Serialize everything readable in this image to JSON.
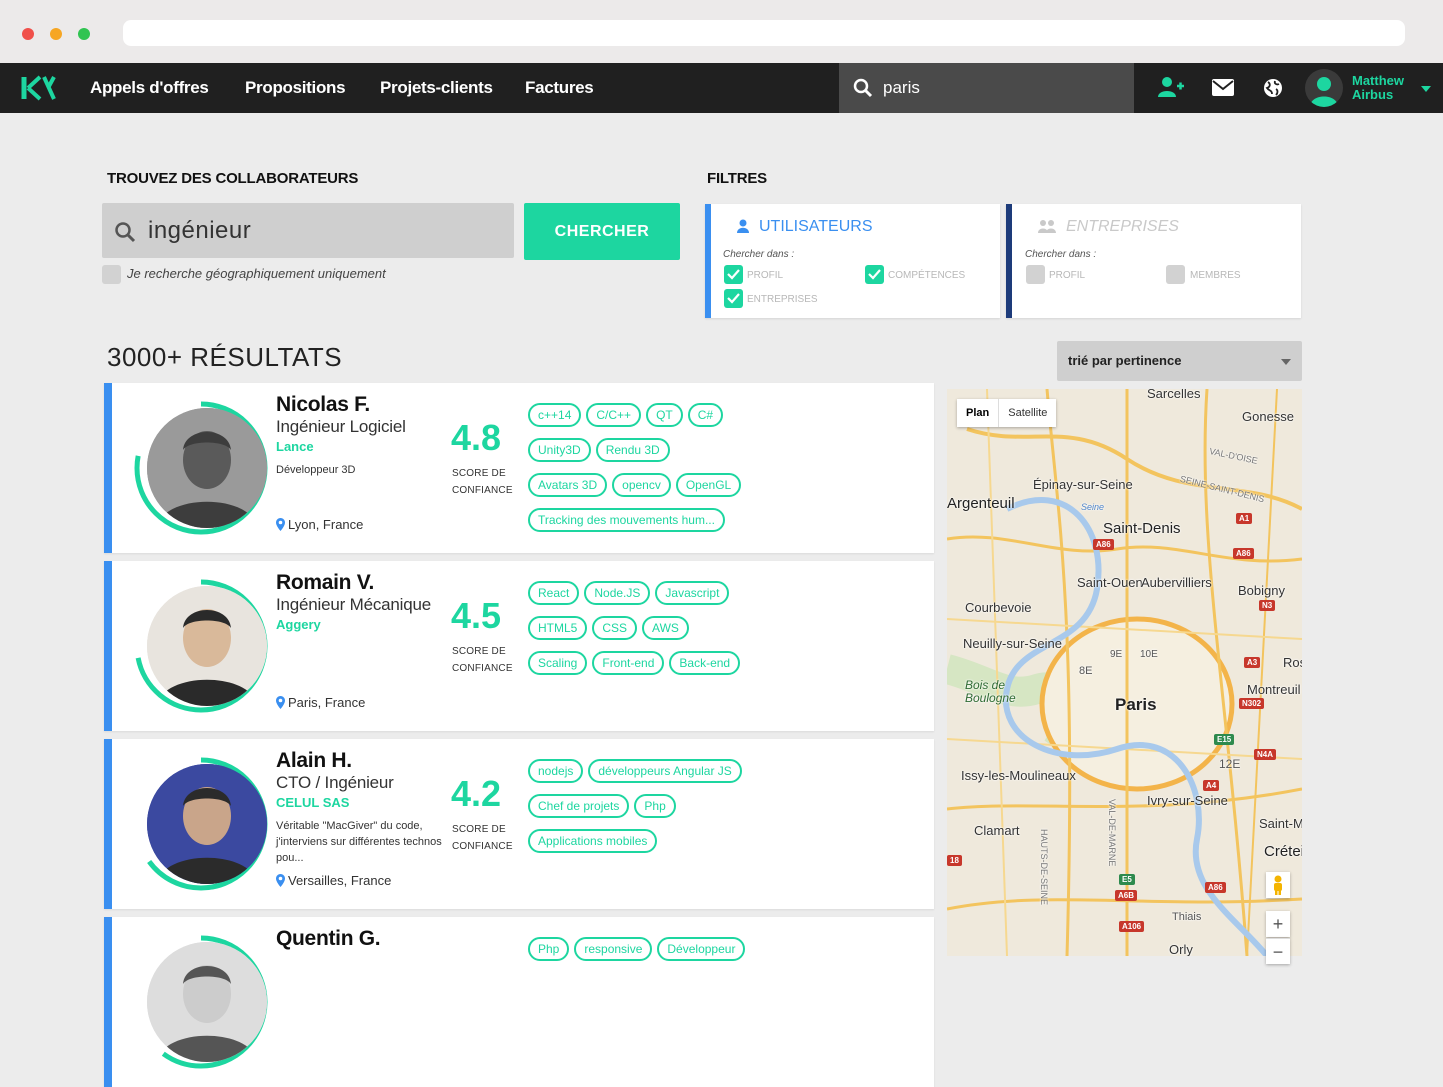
{
  "nav": {
    "links": [
      "Appels d'offres",
      "Propositions",
      "Projets-clients",
      "Factures"
    ],
    "search_value": "paris",
    "user_name_line1": "Matthew",
    "user_name_line2": "Airbus"
  },
  "search": {
    "heading": "TROUVEZ DES COLLABORATEURS",
    "query": "ingénieur",
    "button": "CHERCHER",
    "geo_label": "Je recherche géographiquement uniquement"
  },
  "filters": {
    "heading": "FILTRES",
    "users": {
      "title": "UTILISATEURS",
      "sub": "Chercher dans :",
      "options": [
        {
          "label": "PROFIL",
          "checked": true
        },
        {
          "label": "COMPÉTENCES",
          "checked": true
        },
        {
          "label": "ENTREPRISES",
          "checked": true
        }
      ]
    },
    "companies": {
      "title": "ENTREPRISES",
      "sub": "Chercher dans :",
      "options": [
        {
          "label": "PROFIL",
          "checked": false
        },
        {
          "label": "MEMBRES",
          "checked": false
        }
      ]
    }
  },
  "results": {
    "count_label": "3000+ RÉSULTATS",
    "sort_label": "trié par pertinence",
    "score_label_1": "SCORE DE",
    "score_label_2": "CONFIANCE",
    "items": [
      {
        "name": "Nicolas F.",
        "role": "Ingénieur Logiciel",
        "company": "Lance",
        "desc": "Développeur 3D",
        "location": "Lyon, France",
        "score": "4.8",
        "ring": 0.78,
        "tags": [
          "c++14",
          "C/C++",
          "QT",
          "C#",
          "Unity3D",
          "Rendu 3D",
          "Avatars 3D",
          "opencv",
          "OpenGL",
          "Tracking des mouvements hum..."
        ]
      },
      {
        "name": "Romain V.",
        "role": "Ingénieur Mécanique",
        "company": "Aggery",
        "desc": "",
        "location": "Paris, France",
        "score": "4.5",
        "ring": 0.72,
        "tags": [
          "React",
          "Node.JS",
          "Javascript",
          "HTML5",
          "CSS",
          "AWS",
          "Scaling",
          "Front-end",
          "Back-end"
        ]
      },
      {
        "name": "Alain H.",
        "role": "CTO / Ingénieur",
        "company": "CELUL SAS",
        "desc": "Véritable \"MacGiver\" du code, j'interviens sur différentes technos pou...",
        "location": "Versailles, France",
        "score": "4.2",
        "ring": 0.65,
        "tags": [
          "nodejs",
          "développeurs Angular JS",
          "Chef de projets",
          "Php",
          "Applications mobiles"
        ]
      },
      {
        "name": "Quentin G.",
        "role": "",
        "company": "",
        "desc": "",
        "location": "",
        "score": "",
        "ring": 0.6,
        "tags": [
          "Php",
          "responsive",
          "Développeur"
        ]
      }
    ]
  },
  "map": {
    "types": [
      "Plan",
      "Satellite"
    ],
    "labels": [
      "Sarcelles",
      "Gonesse",
      "Argenteuil",
      "Épinay-sur-Seine",
      "Saint-Denis",
      "Saint-Ouen",
      "Aubervilliers",
      "Bobigny",
      "Courbevoie",
      "Neuilly-sur-Seine",
      "Paris",
      "Montreuil",
      "Issy-les-Moulineaux",
      "Ivry-sur-Seine",
      "Clamart",
      "Créteil",
      "Thiais",
      "Orly",
      "Bois de Boulogne",
      "8E",
      "9E",
      "10E",
      "12E",
      "Seine",
      "VAL-D'OISE",
      "SEINE-SAINT-DENIS",
      "Ros",
      "Saint-M",
      "HAUTS-DE-SEINE",
      "VAL-DE-MARNE"
    ],
    "badges": [
      "A1",
      "A86",
      "A86",
      "N3",
      "A3",
      "N302",
      "E15",
      "N4A",
      "A4",
      "E5",
      "A6B",
      "A86",
      "A106",
      "18"
    ],
    "zoom_in": "+",
    "zoom_out": "−"
  },
  "colors": {
    "accent": "#1dd6a0",
    "blue": "#3a8ff0",
    "nav": "#202020"
  }
}
